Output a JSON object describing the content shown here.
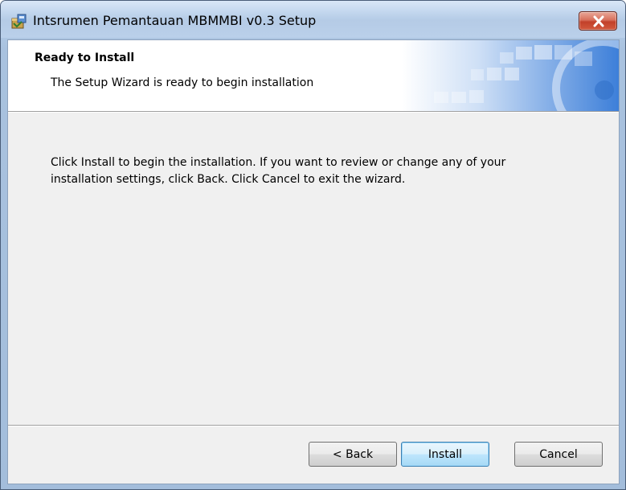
{
  "window": {
    "title": "Intsrumen Pemantauan MBMMBI v0.3 Setup",
    "icon": "installer-package-icon",
    "close_icon": "close-icon"
  },
  "banner": {
    "title": "Ready to Install",
    "subtitle": "The Setup Wizard is ready to begin installation"
  },
  "body": {
    "text": "Click Install to begin the installation.  If you want to review or change any of your\ninstallation settings, click Back.  Click Cancel to exit the wizard."
  },
  "buttons": {
    "back": "< Back",
    "install": "Install",
    "cancel": "Cancel"
  },
  "colors": {
    "titlebar": "#bad0ea",
    "client_bg": "#f0f0f0",
    "close_button": "#c2412a",
    "default_button_border": "#3c7fb1"
  }
}
